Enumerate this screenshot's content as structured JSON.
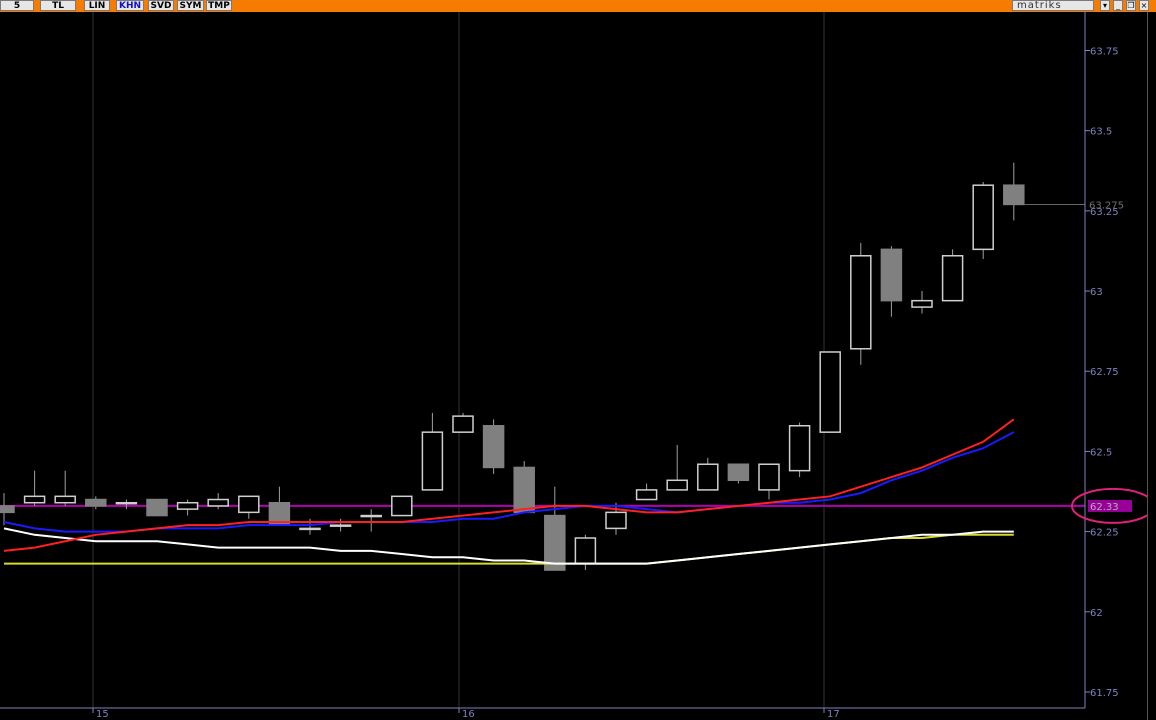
{
  "toolbar": {
    "buttons": [
      {
        "label": "5",
        "active": false
      },
      {
        "label": "TL",
        "active": false
      },
      {
        "label": "LIN",
        "active": false
      },
      {
        "label": "KHN",
        "active": true
      },
      {
        "label": "SVD",
        "active": false
      },
      {
        "label": "SYM",
        "active": false
      },
      {
        "label": "TMP",
        "active": false
      }
    ],
    "brand": "matriks",
    "window_icons": [
      "dropdown-icon",
      "minimize-icon",
      "restore-icon",
      "close-icon"
    ]
  },
  "colors": {
    "toolbar_bg": "#f57c00",
    "background": "#000000",
    "axis_text": "#8080c0",
    "grid": "#333333",
    "candle_up": "#cfcfcf",
    "candle_down_fill": "#808080",
    "ma_red": "#ff2020",
    "ma_blue": "#1a1aff",
    "ma_white": "#ffffff",
    "ma_yellow": "#d8d830",
    "hline": "#b000b0",
    "price_tag": "#990099",
    "highlight_circle": "#e0207a"
  },
  "chart_data": {
    "type": "candlestick",
    "y_ticks": [
      "63.75",
      "63.5",
      "63.25",
      "63",
      "62.75",
      "62.5",
      "62.25",
      "62",
      "61.75"
    ],
    "ylim": [
      61.7,
      63.87
    ],
    "x_ticks": [
      "15",
      "16",
      "17"
    ],
    "last_price_label": "63.275",
    "horizontal_line_value": 62.33,
    "horizontal_line_label": "62.33",
    "candles": [
      {
        "o": 62.33,
        "h": 62.37,
        "l": 62.27,
        "c": 62.31
      },
      {
        "o": 62.34,
        "h": 62.44,
        "l": 62.33,
        "c": 62.36
      },
      {
        "o": 62.34,
        "h": 62.44,
        "l": 62.33,
        "c": 62.36
      },
      {
        "o": 62.35,
        "h": 62.36,
        "l": 62.32,
        "c": 62.33
      },
      {
        "o": 62.34,
        "h": 62.35,
        "l": 62.32,
        "c": 62.34
      },
      {
        "o": 62.35,
        "h": 62.35,
        "l": 62.3,
        "c": 62.3
      },
      {
        "o": 62.32,
        "h": 62.35,
        "l": 62.3,
        "c": 62.34
      },
      {
        "o": 62.33,
        "h": 62.37,
        "l": 62.32,
        "c": 62.35
      },
      {
        "o": 62.31,
        "h": 62.36,
        "l": 62.29,
        "c": 62.36
      },
      {
        "o": 62.34,
        "h": 62.39,
        "l": 62.27,
        "c": 62.27
      },
      {
        "o": 62.26,
        "h": 62.29,
        "l": 62.24,
        "c": 62.26
      },
      {
        "o": 62.27,
        "h": 62.29,
        "l": 62.25,
        "c": 62.27
      },
      {
        "o": 62.3,
        "h": 62.32,
        "l": 62.25,
        "c": 62.3
      },
      {
        "o": 62.3,
        "h": 62.36,
        "l": 62.3,
        "c": 62.36
      },
      {
        "o": 62.38,
        "h": 62.62,
        "l": 62.38,
        "c": 62.56
      },
      {
        "o": 62.56,
        "h": 62.62,
        "l": 62.56,
        "c": 62.61
      },
      {
        "o": 62.58,
        "h": 62.6,
        "l": 62.43,
        "c": 62.45
      },
      {
        "o": 62.45,
        "h": 62.47,
        "l": 62.31,
        "c": 62.31
      },
      {
        "o": 62.3,
        "h": 62.39,
        "l": 62.13,
        "c": 62.13
      },
      {
        "o": 62.15,
        "h": 62.24,
        "l": 62.13,
        "c": 62.23
      },
      {
        "o": 62.26,
        "h": 62.34,
        "l": 62.24,
        "c": 62.31
      },
      {
        "o": 62.35,
        "h": 62.4,
        "l": 62.35,
        "c": 62.38
      },
      {
        "o": 62.38,
        "h": 62.52,
        "l": 62.38,
        "c": 62.41
      },
      {
        "o": 62.38,
        "h": 62.48,
        "l": 62.38,
        "c": 62.46
      },
      {
        "o": 62.46,
        "h": 62.46,
        "l": 62.4,
        "c": 62.41
      },
      {
        "o": 62.38,
        "h": 62.46,
        "l": 62.35,
        "c": 62.46
      },
      {
        "o": 62.44,
        "h": 62.59,
        "l": 62.42,
        "c": 62.58
      },
      {
        "o": 62.56,
        "h": 62.81,
        "l": 62.56,
        "c": 62.81
      },
      {
        "o": 62.82,
        "h": 63.15,
        "l": 62.77,
        "c": 63.11
      },
      {
        "o": 63.13,
        "h": 63.14,
        "l": 62.92,
        "c": 62.97
      },
      {
        "o": 62.95,
        "h": 63.0,
        "l": 62.93,
        "c": 62.97
      },
      {
        "o": 62.97,
        "h": 63.13,
        "l": 62.97,
        "c": 63.11
      },
      {
        "o": 63.13,
        "h": 63.34,
        "l": 63.1,
        "c": 63.33
      },
      {
        "o": 63.33,
        "h": 63.4,
        "l": 63.22,
        "c": 63.27
      }
    ],
    "series": [
      {
        "color": "red",
        "values": [
          62.19,
          62.2,
          62.22,
          62.24,
          62.25,
          62.26,
          62.27,
          62.27,
          62.28,
          62.28,
          62.28,
          62.28,
          62.28,
          62.28,
          62.29,
          62.3,
          62.31,
          62.32,
          62.33,
          62.33,
          62.32,
          62.31,
          62.31,
          62.32,
          62.33,
          62.34,
          62.35,
          62.36,
          62.39,
          62.42,
          62.45,
          62.49,
          62.53,
          62.6
        ]
      },
      {
        "color": "blue",
        "values": [
          62.28,
          62.26,
          62.25,
          62.25,
          62.25,
          62.26,
          62.26,
          62.26,
          62.27,
          62.27,
          62.27,
          62.28,
          62.28,
          62.28,
          62.28,
          62.29,
          62.29,
          62.31,
          62.32,
          62.33,
          62.33,
          62.32,
          62.31,
          62.32,
          62.33,
          62.34,
          62.34,
          62.35,
          62.37,
          62.41,
          62.44,
          62.48,
          62.51,
          62.56
        ]
      },
      {
        "color": "white",
        "values": [
          62.26,
          62.24,
          62.23,
          62.22,
          62.22,
          62.22,
          62.21,
          62.2,
          62.2,
          62.2,
          62.2,
          62.19,
          62.19,
          62.18,
          62.17,
          62.17,
          62.16,
          62.16,
          62.15,
          62.15,
          62.15,
          62.15,
          62.16,
          62.17,
          62.18,
          62.19,
          62.2,
          62.21,
          62.22,
          62.23,
          62.24,
          62.24,
          62.25,
          62.25
        ]
      },
      {
        "color": "yellow",
        "values": [
          62.15,
          62.15,
          62.15,
          62.15,
          62.15,
          62.15,
          62.15,
          62.15,
          62.15,
          62.15,
          62.15,
          62.15,
          62.15,
          62.15,
          62.15,
          62.15,
          62.15,
          62.15,
          62.15,
          62.15,
          62.15,
          62.15,
          62.16,
          62.17,
          62.18,
          62.19,
          62.2,
          62.21,
          62.22,
          62.23,
          62.23,
          62.24,
          62.24,
          62.24
        ]
      }
    ]
  }
}
